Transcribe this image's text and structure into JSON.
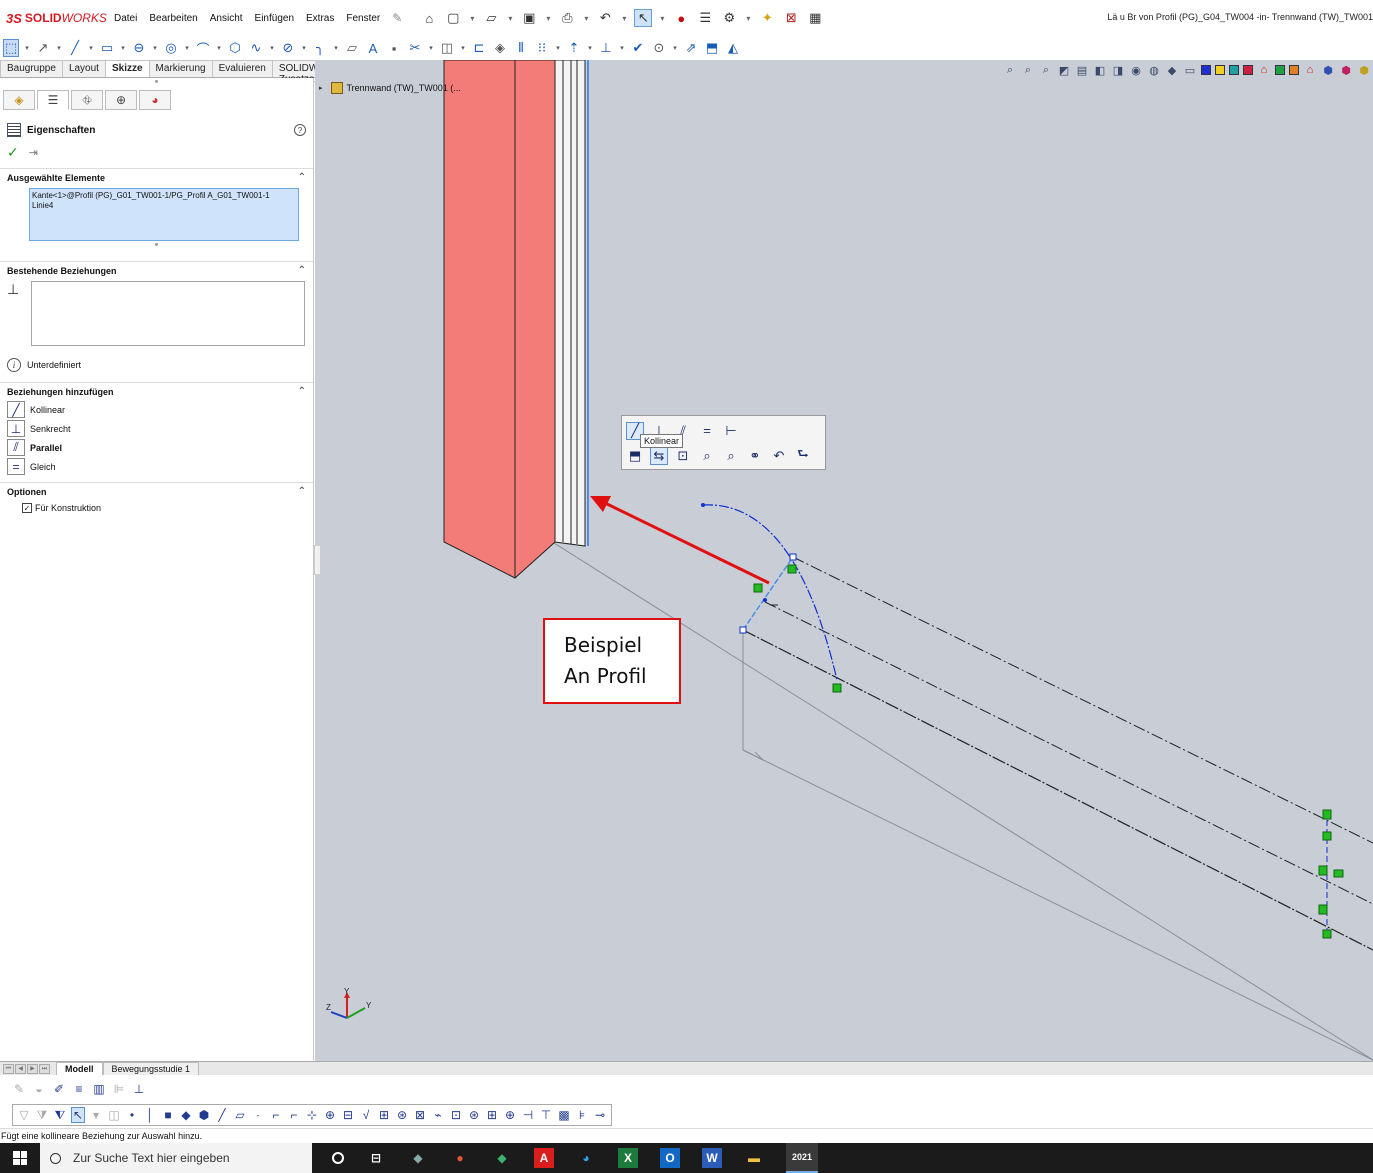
{
  "app": {
    "logo_ds": "3S",
    "logo_solid": "SOLID",
    "logo_works": "WORKS",
    "menu": [
      "Datei",
      "Bearbeiten",
      "Ansicht",
      "Einfügen",
      "Extras",
      "Fenster"
    ],
    "document_title": "Lä u Br von Profil (PG)_G04_TW004 -in- Trennwand (TW)_TW001"
  },
  "command_tabs": [
    "Baugruppe",
    "Layout",
    "Skizze",
    "Markierung",
    "Evaluieren",
    "SOLIDWORKS Zusatzanwendungen"
  ],
  "active_command_tab": "Skizze",
  "property_manager": {
    "title": "Eigenschaften",
    "selected_section": {
      "heading": "Ausgewählte Elemente",
      "item_line1": "Kante<1>@Profil (PG)_G01_TW001-1/PG_Profil A_G01_TW001-1",
      "item_line2": "Linie4"
    },
    "existing_relations": {
      "heading": "Bestehende Beziehungen"
    },
    "status": "Unterdefiniert",
    "add_relations": {
      "heading": "Beziehungen hinzufügen",
      "items": [
        {
          "label": "Kollinear",
          "bold": false,
          "icon": "collinear-icon"
        },
        {
          "label": "Senkrecht",
          "bold": false,
          "icon": "perpendicular-icon"
        },
        {
          "label": "Parallel",
          "bold": true,
          "icon": "parallel-icon"
        },
        {
          "label": "Gleich",
          "bold": false,
          "icon": "equal-icon"
        }
      ]
    },
    "options": {
      "heading": "Optionen",
      "construction_label": "Für Konstruktion",
      "construction_checked": true
    }
  },
  "viewport": {
    "tree_item": "Trennwand (TW)_TW001 (...",
    "tooltip": "Kollinear",
    "annotation_line1": "Beispiel",
    "annotation_line2": "An Profil",
    "colors": {
      "background": "#c8cdd6",
      "profile_red": "#f47c78",
      "arrow_red": "#e01010",
      "sketch_blue": "#1030d0",
      "relation_green": "#22bb22"
    }
  },
  "bottom_tabs": [
    "Modell",
    "Bewegungsstudie 1"
  ],
  "active_bottom_tab": "Modell",
  "status_text": "Fügt eine kollineare Beziehung zur Auswahl hinzu.",
  "taskbar": {
    "search_placeholder": "Zur Suche Text hier eingeben",
    "sw_label": "2021"
  }
}
